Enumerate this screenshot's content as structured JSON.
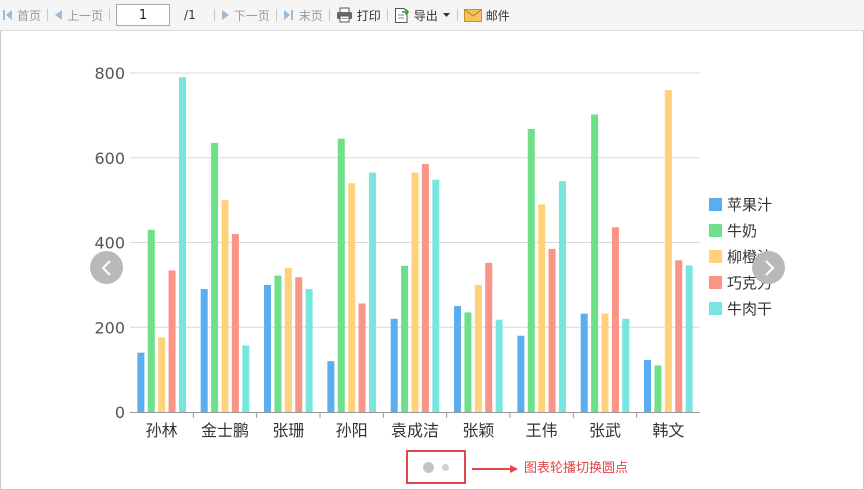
{
  "toolbar": {
    "first_label": "首页",
    "prev_label": "上一页",
    "page_value": "1",
    "page_total": "/1",
    "next_label": "下一页",
    "last_label": "末页",
    "print_label": "打印",
    "export_label": "导出",
    "mail_label": "邮件"
  },
  "annotation": {
    "text": "图表轮播切换圆点",
    "color": "#e0464c"
  },
  "chart_data": {
    "type": "bar",
    "categories": [
      "孙林",
      "金士鹏",
      "张珊",
      "孙阳",
      "袁成洁",
      "张颖",
      "王伟",
      "张武",
      "韩文"
    ],
    "series": [
      {
        "name": "苹果汁",
        "color": "#5aaef0",
        "values": [
          140,
          290,
          300,
          120,
          220,
          250,
          180,
          232,
          123
        ]
      },
      {
        "name": "牛奶",
        "color": "#6fe08a",
        "values": [
          430,
          635,
          322,
          645,
          345,
          235,
          668,
          702,
          110
        ]
      },
      {
        "name": "柳橙汁",
        "color": "#fdd27a",
        "values": [
          176,
          500,
          340,
          540,
          565,
          300,
          490,
          232,
          760
        ]
      },
      {
        "name": "巧克力",
        "color": "#f99487",
        "values": [
          334,
          420,
          318,
          256,
          585,
          352,
          385,
          436,
          358
        ]
      },
      {
        "name": "牛肉干",
        "color": "#76e6df",
        "values": [
          790,
          157,
          290,
          565,
          548,
          218,
          545,
          220,
          346
        ]
      }
    ],
    "yticks": [
      "0",
      "200",
      "400",
      "600",
      "800"
    ],
    "ylim": [
      0,
      800
    ],
    "grid": true,
    "legend_position": "right"
  }
}
